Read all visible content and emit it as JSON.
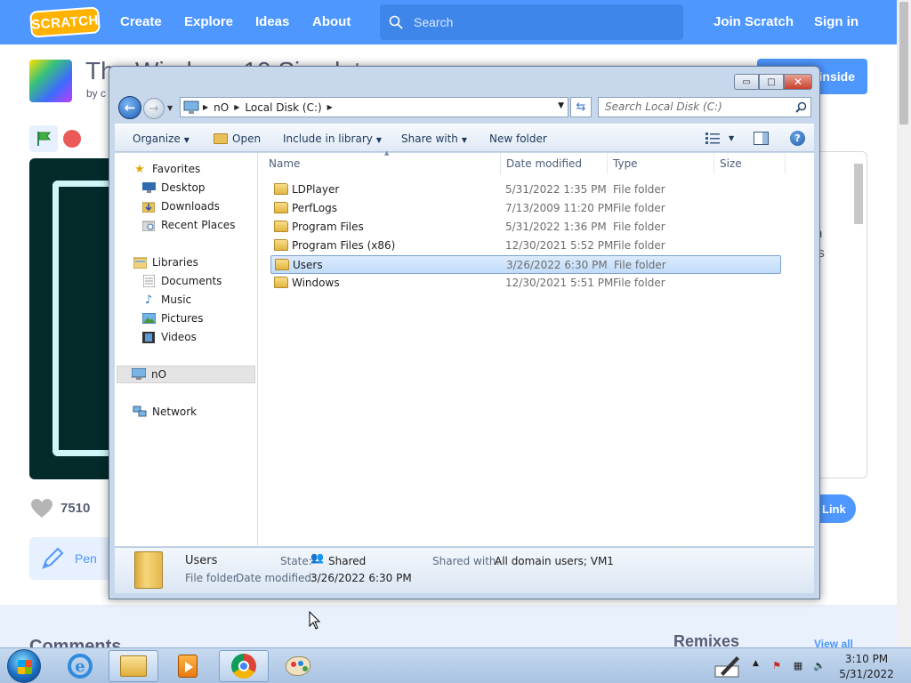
{
  "scratch": {
    "logo": "SCRATCH",
    "nav": {
      "create": "Create",
      "explore": "Explore",
      "ideas": "Ideas",
      "about": "About",
      "join": "Join Scratch",
      "signin": "Sign in"
    },
    "search_placeholder": "Search",
    "project_title": "The Windows 10 Simulator",
    "project_by": "by c",
    "see_inside": "inside",
    "love_count": "7510",
    "pen_label": "Pen",
    "copy_link": "Link",
    "instructions_fragment": "n\nis",
    "comments_heading": "Comments",
    "remixes_heading": "Remixes",
    "view_all": "View all"
  },
  "explorer": {
    "caption_buttons": {
      "minimize": "▭",
      "maximize": "□",
      "close": "✕"
    },
    "address": {
      "segments": [
        "nO",
        "Local Disk (C:)"
      ]
    },
    "search_placeholder": "Search Local Disk (C:)",
    "toolbar": {
      "organize": "Organize",
      "open": "Open",
      "include_in_library": "Include in library",
      "share_with": "Share with",
      "new_folder": "New folder"
    },
    "nav": {
      "favorites": "Favorites",
      "desktop": "Desktop",
      "downloads": "Downloads",
      "recent_places": "Recent Places",
      "libraries": "Libraries",
      "documents": "Documents",
      "music": "Music",
      "pictures": "Pictures",
      "videos": "Videos",
      "computer": "nO",
      "network": "Network"
    },
    "columns": {
      "name": "Name",
      "date_modified": "Date modified",
      "type": "Type",
      "size": "Size"
    },
    "files": [
      {
        "name": "LDPlayer",
        "date": "5/31/2022 1:35 PM",
        "type": "File folder"
      },
      {
        "name": "PerfLogs",
        "date": "7/13/2009 11:20 PM",
        "type": "File folder"
      },
      {
        "name": "Program Files",
        "date": "5/31/2022 1:36 PM",
        "type": "File folder"
      },
      {
        "name": "Program Files (x86)",
        "date": "12/30/2021 5:52 PM",
        "type": "File folder"
      },
      {
        "name": "Users",
        "date": "3/26/2022 6:30 PM",
        "type": "File folder"
      },
      {
        "name": "Windows",
        "date": "12/30/2021 5:51 PM",
        "type": "File folder"
      }
    ],
    "selected_index": 4,
    "details": {
      "name": "Users",
      "kind": "File folder",
      "state_label": "State:",
      "state_value": "Shared",
      "shared_label": "Shared with:",
      "shared_value": "All domain users; VM1",
      "date_label": "Date modified:",
      "date_value": "3/26/2022 6:30 PM"
    }
  },
  "taskbar": {
    "clock_time": "3:10 PM",
    "clock_date": "5/31/2022",
    "ie_glyph": "e"
  },
  "colors": {
    "scratch_blue": "#4d97ff",
    "win7_frame": "#c7d8ec",
    "selection": "#c1dcfb"
  }
}
